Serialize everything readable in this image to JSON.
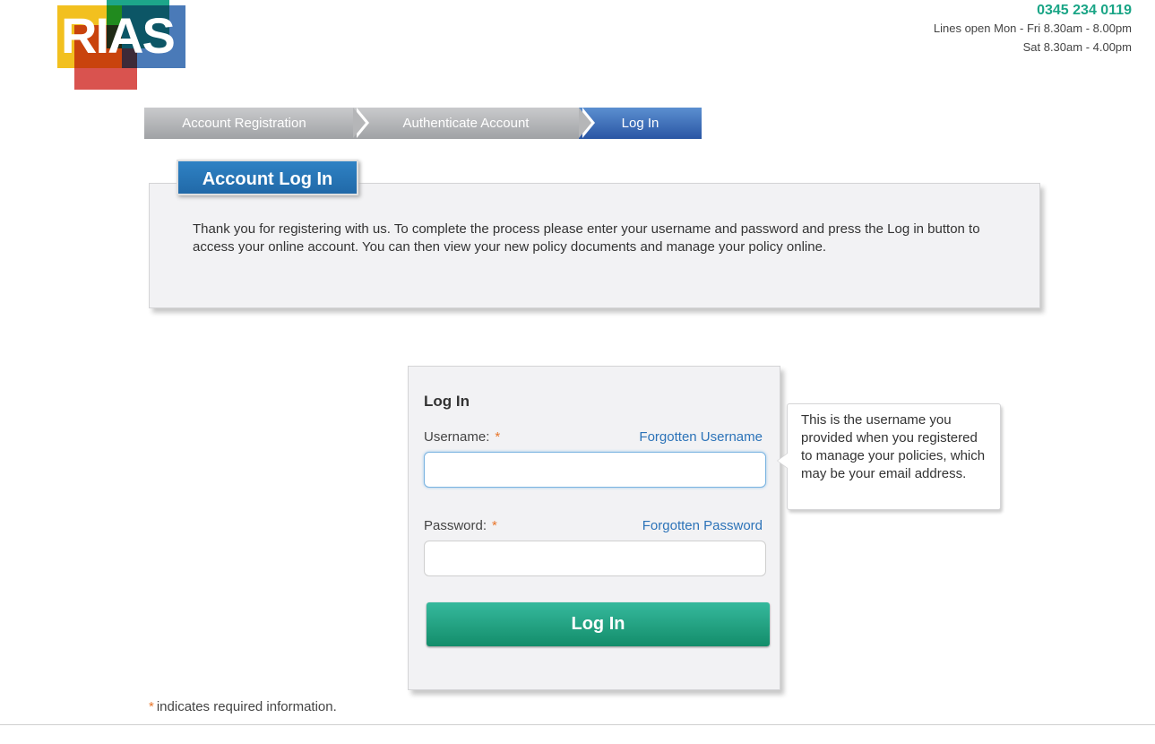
{
  "header": {
    "logo_text": "RIAS",
    "phone": "0345 234 0119",
    "hours_weekday": "Lines open Mon - Fri 8.30am - 8.00pm",
    "hours_saturday": "Sat 8.30am - 4.00pm"
  },
  "steps": [
    {
      "label": "Account Registration",
      "state": "complete"
    },
    {
      "label": "Authenticate Account",
      "state": "complete"
    },
    {
      "label": "Log In",
      "state": "active"
    }
  ],
  "info_panel": {
    "title": "Account Log In",
    "text": "Thank you for registering with us. To complete the process please enter your username and password and press the Log in button to access your online account. You can then view your new policy documents and manage your policy online."
  },
  "login_form": {
    "heading": "Log In",
    "username_label": "Username:",
    "username_value": "",
    "forgot_username": "Forgotten Username",
    "password_label": "Password:",
    "password_value": "",
    "forgot_password": "Forgotten Password",
    "required_marker": "*",
    "submit_label": "Log In"
  },
  "tooltip": {
    "text": "This is the username you provided when you registered to manage your policies, which may be your email address."
  },
  "footnote": {
    "marker": "*",
    "text": "indicates required information."
  },
  "colors": {
    "brand_green": "#1aa586",
    "brand_blue": "#2169a8",
    "link": "#2c73b8",
    "required": "#e8762b"
  }
}
